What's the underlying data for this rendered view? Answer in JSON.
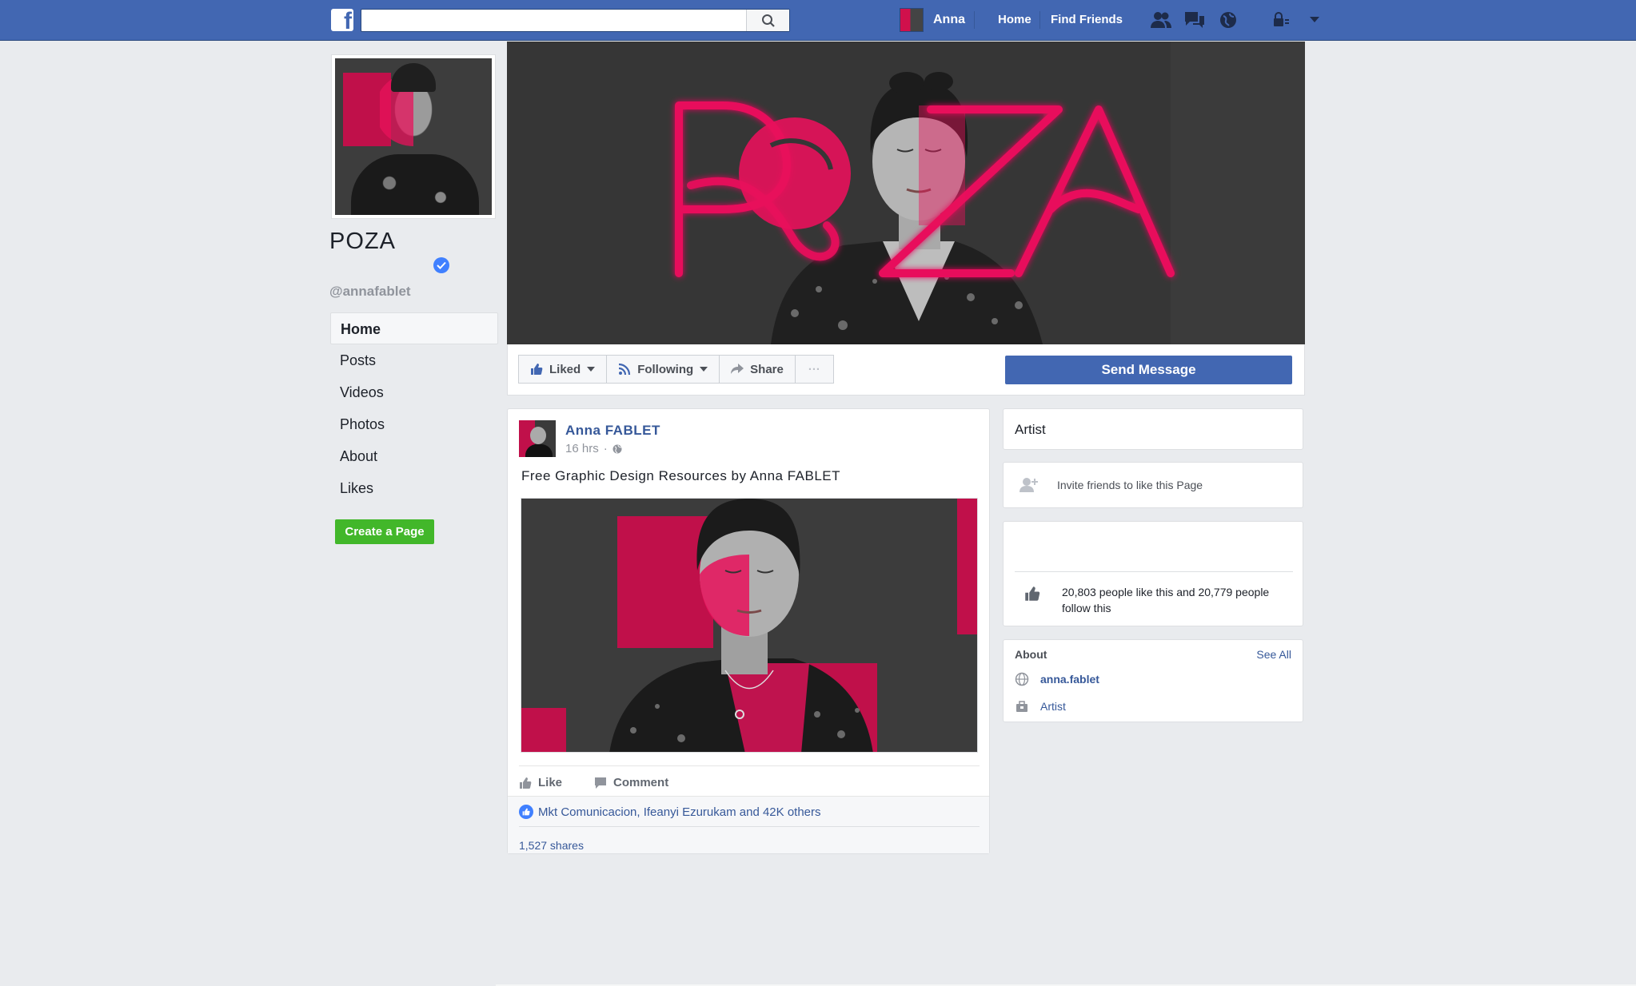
{
  "topbar": {
    "logo_letter": "f",
    "search_placeholder": "",
    "user_name": "Anna",
    "nav_home": "Home",
    "nav_find_friends": "Find Friends",
    "brand_color": "#4267b2"
  },
  "page": {
    "name": "POZA",
    "handle": "@annafablet",
    "verified": true
  },
  "cover": {
    "title": "POZA",
    "neon_color": "#e8115b"
  },
  "leftnav": {
    "items": [
      {
        "label": "Home",
        "active": true
      },
      {
        "label": "Posts"
      },
      {
        "label": "Videos"
      },
      {
        "label": "Photos"
      },
      {
        "label": "About"
      },
      {
        "label": "Likes"
      }
    ],
    "create_page": "Create a Page"
  },
  "actions": {
    "liked": "Liked",
    "following": "Following",
    "share": "Share",
    "more": "···",
    "send_message": "Send Message"
  },
  "post": {
    "author": "Anna FABLET",
    "time": "16 hrs",
    "dot": "·",
    "text": "Free Graphic Design Resources by Anna FABLET",
    "like": "Like",
    "comment": "Comment",
    "likes_summary": "Mkt Comunicacion, Ifeanyi Ezurukam and 42K others",
    "shares": "1,527 shares"
  },
  "sidebar": {
    "category": "Artist",
    "invite": "Invite friends to like this Page",
    "community": "20,803 people like this and 20,779 people follow this",
    "about_title": "About",
    "see_all": "See All",
    "website": "anna.fablet",
    "category_link": "Artist"
  }
}
